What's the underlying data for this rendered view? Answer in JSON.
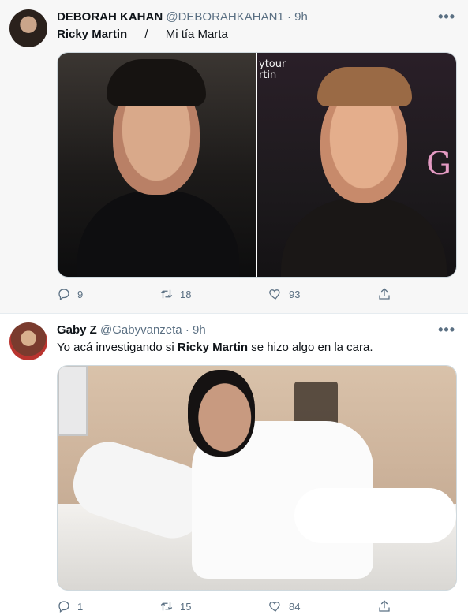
{
  "tweets": [
    {
      "name": "DEBORAH KAHAN",
      "handle": "@DEBORAHKAHAN1",
      "dot": "·",
      "time": "9h",
      "more": "•••",
      "text": {
        "part1": "Ricky Martin",
        "sep": "/",
        "part2": "Mi tía Marta"
      },
      "media": {
        "overlay_text": "ytour\nrtin",
        "pink_glyph": "G"
      },
      "counts": {
        "reply": "9",
        "retweet": "18",
        "like": "93"
      }
    },
    {
      "name": "Gaby Z⁣",
      "handle": "@Gabyvanzeta",
      "dot": "·",
      "time": "9h",
      "more": "•••",
      "text": {
        "before": "Yo acá investigando si ",
        "bold": "Ricky Martin",
        "after": " se hizo algo en la cara."
      },
      "counts": {
        "reply": "1",
        "retweet": "15",
        "like": "84"
      }
    }
  ],
  "icons": [
    "more-icon",
    "reply-icon",
    "retweet-icon",
    "like-icon",
    "share-icon"
  ],
  "colors": {
    "muted": "#5b7083",
    "text": "#0f1419",
    "highlight_bg": "#f7f7f7"
  }
}
